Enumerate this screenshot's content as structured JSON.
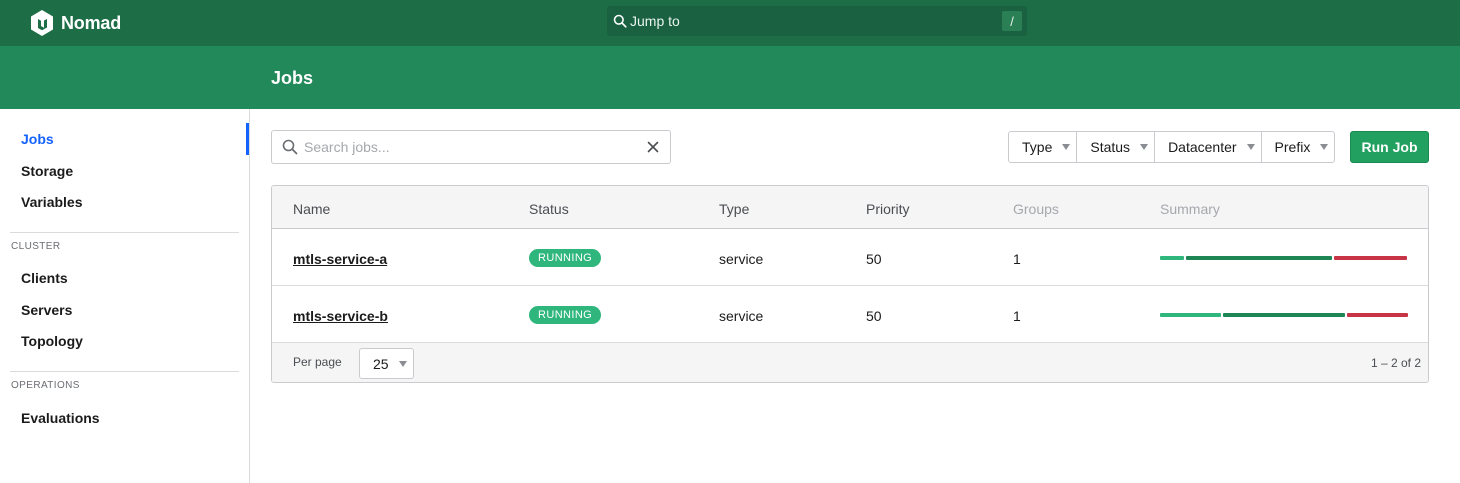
{
  "brand": {
    "name": "Nomad",
    "icon": "nomad-logo-icon"
  },
  "jump": {
    "label": "Jump to",
    "shortcut": "/"
  },
  "page": {
    "title": "Jobs"
  },
  "sidebar": {
    "items": [
      {
        "label": "Jobs",
        "active": true
      },
      {
        "label": "Storage"
      },
      {
        "label": "Variables"
      }
    ],
    "cluster": {
      "heading": "CLUSTER",
      "items": [
        {
          "label": "Clients"
        },
        {
          "label": "Servers"
        },
        {
          "label": "Topology"
        }
      ]
    },
    "operations": {
      "heading": "OPERATIONS",
      "items": [
        {
          "label": "Evaluations"
        }
      ]
    }
  },
  "search": {
    "placeholder": "Search jobs...",
    "value": ""
  },
  "filters": [
    "Type",
    "Status",
    "Datacenter",
    "Prefix"
  ],
  "run_job": "Run Job",
  "table": {
    "columns": [
      "Name",
      "Status",
      "Type",
      "Priority",
      "Groups",
      "Summary"
    ],
    "rows": [
      {
        "name": "mtls-service-a",
        "status": "RUNNING",
        "type": "service",
        "priority": "50",
        "groups": "1",
        "summary": [
          {
            "fraction": 0.1,
            "color": "#2eb67d"
          },
          {
            "fraction": 0.6,
            "color": "#1e8555"
          },
          {
            "fraction": 0.3,
            "color": "#c73445"
          }
        ]
      },
      {
        "name": "mtls-service-b",
        "status": "RUNNING",
        "type": "service",
        "priority": "50",
        "groups": "1",
        "summary": [
          {
            "fraction": 0.25,
            "color": "#2eb67d"
          },
          {
            "fraction": 0.5,
            "color": "#1e8555"
          },
          {
            "fraction": 0.25,
            "color": "#c73445"
          }
        ]
      }
    ]
  },
  "pagination": {
    "label": "Per page",
    "size": "25",
    "info": "1 – 2 of 2"
  },
  "colors": {
    "header": "#1d6e47",
    "subheader": "#22895a",
    "accent": "#1563ff",
    "running": "#2eb67d",
    "primary_button": "#22a05f"
  }
}
